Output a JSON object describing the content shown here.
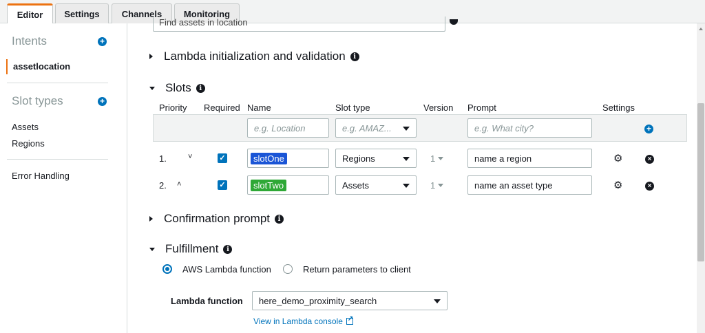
{
  "tabs": [
    {
      "label": "Editor",
      "active": true
    },
    {
      "label": "Settings",
      "active": false
    },
    {
      "label": "Channels",
      "active": false
    },
    {
      "label": "Monitoring",
      "active": false
    }
  ],
  "sidebar": {
    "intents_heading": "Intents",
    "intents": [
      {
        "label": "assetlocation",
        "selected": true
      }
    ],
    "slot_types_heading": "Slot types",
    "slot_types": [
      {
        "label": "Assets"
      },
      {
        "label": "Regions"
      }
    ],
    "error_handling": "Error Handling"
  },
  "main": {
    "top_utterance": "Find assets in location",
    "lambda_init": {
      "title": "Lambda initialization and validation",
      "expanded": false
    },
    "slots": {
      "title": "Slots",
      "expanded": true,
      "columns": [
        "Priority",
        "Required",
        "Name",
        "Slot type",
        "Version",
        "Prompt",
        "Settings"
      ],
      "new_row": {
        "name_placeholder": "e.g. Location",
        "slot_type_placeholder": "e.g. AMAZ...",
        "prompt_placeholder": "e.g. What city?"
      },
      "rows": [
        {
          "priority": "1.",
          "chevron": "˅",
          "required": true,
          "name": "slotOne",
          "name_color": "#1a55d6",
          "slot_type": "Regions",
          "version": "1",
          "prompt": "name a region"
        },
        {
          "priority": "2.",
          "chevron": "˄",
          "required": true,
          "name": "slotTwo",
          "name_color": "#2ea836",
          "slot_type": "Assets",
          "version": "1",
          "prompt": "name an asset type"
        }
      ]
    },
    "confirmation": {
      "title": "Confirmation prompt",
      "expanded": false
    },
    "fulfillment": {
      "title": "Fulfillment",
      "expanded": true,
      "options": [
        {
          "label": "AWS Lambda function",
          "selected": true
        },
        {
          "label": "Return parameters to client",
          "selected": false
        }
      ],
      "lambda_label": "Lambda function",
      "lambda_value": "here_demo_proximity_search",
      "console_link": "View in Lambda console"
    }
  },
  "colors": {
    "accent": "#ec7211",
    "primary": "#0073bb"
  }
}
